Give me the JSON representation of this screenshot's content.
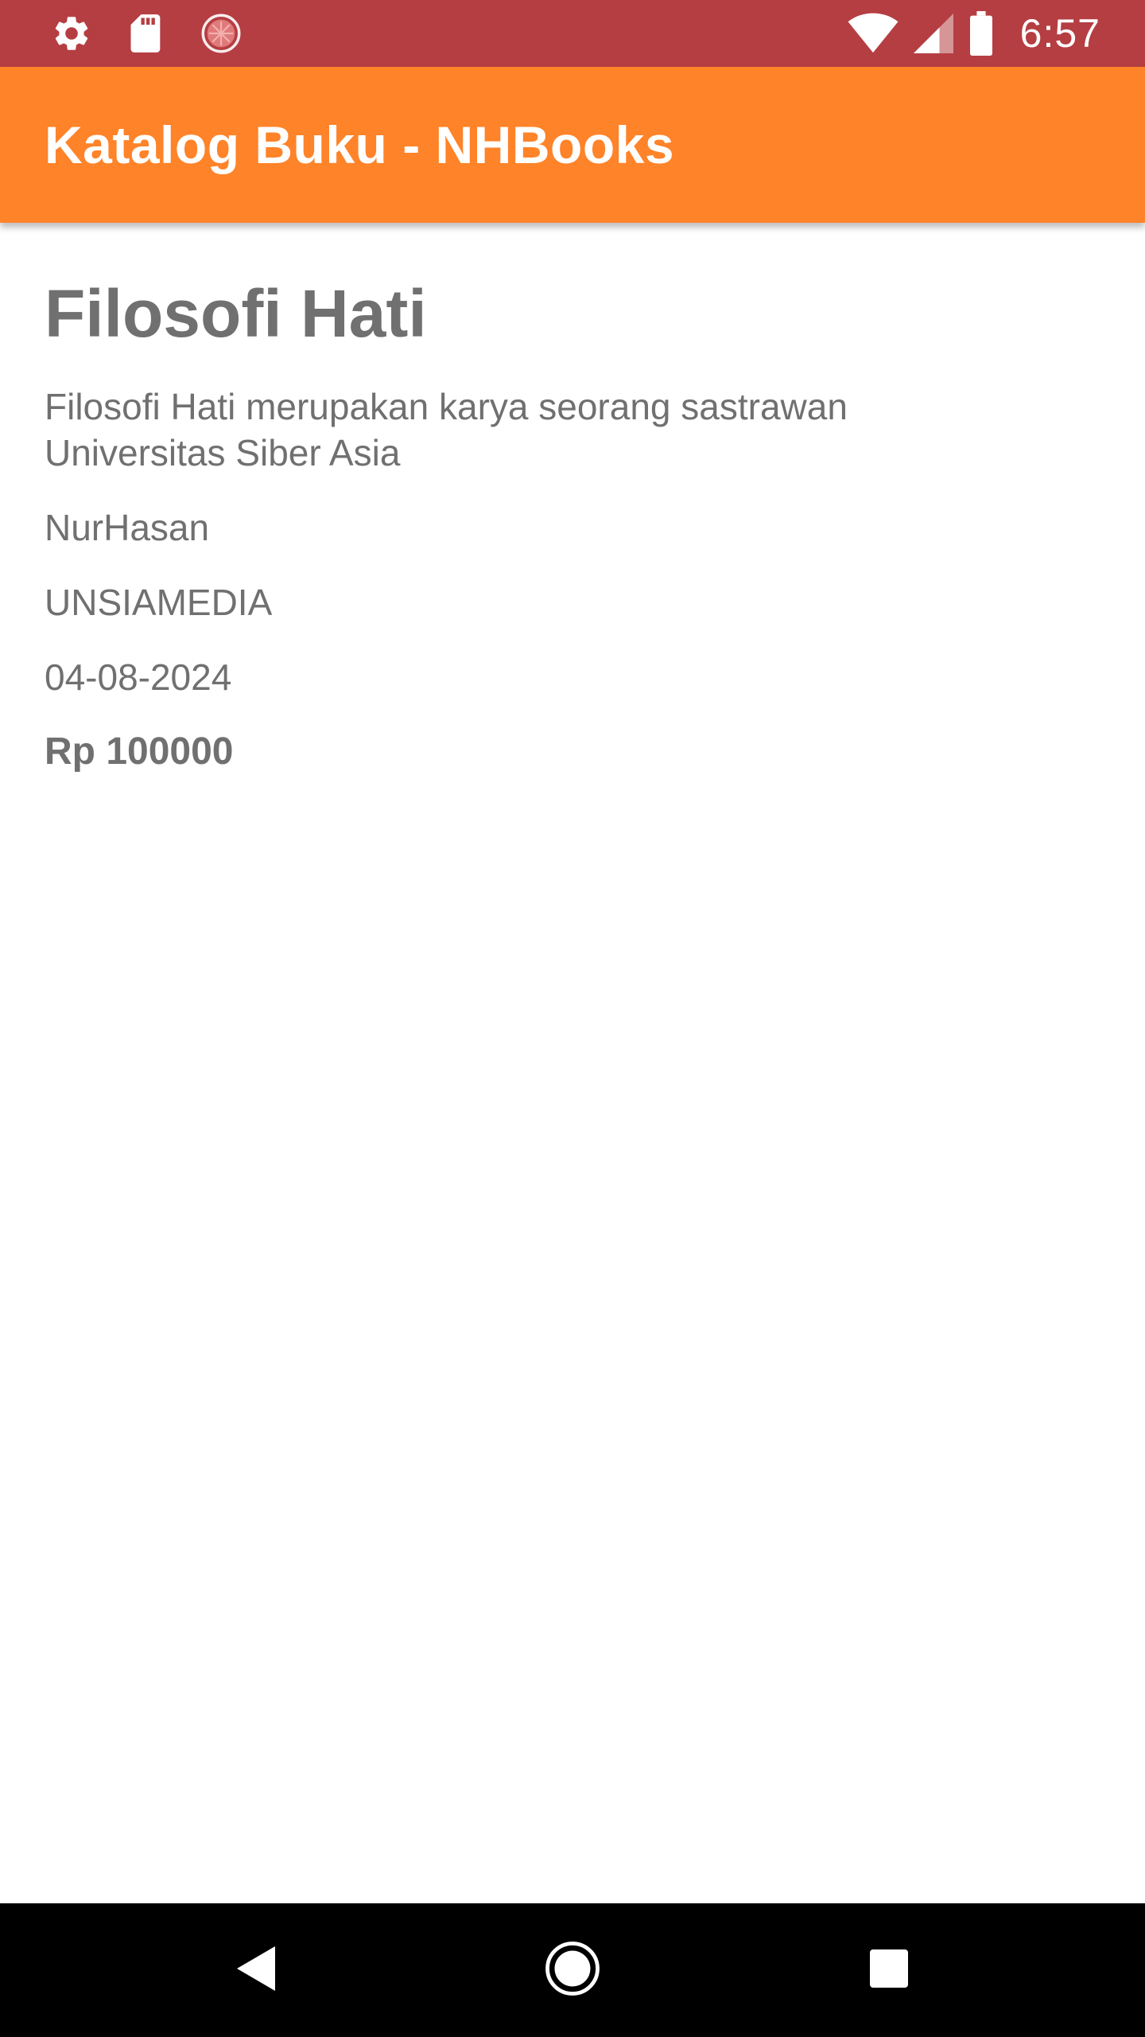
{
  "status_bar": {
    "time": "6:57",
    "background": "#b53e42",
    "left_icons": [
      "gear-icon",
      "sd-card-icon",
      "sync-progress-icon"
    ],
    "right_icons": [
      "wifi-icon",
      "cell-signal-icon",
      "battery-icon"
    ]
  },
  "app_bar": {
    "title": "Katalog Buku - NHBooks",
    "background": "#ff8329"
  },
  "book": {
    "title": "Filosofi Hati",
    "description": "Filosofi Hati merupakan karya seorang sastrawan Universitas Siber Asia",
    "author": "NurHasan",
    "publisher": "UNSIAMEDIA",
    "date": "04-08-2024",
    "price": "Rp 100000",
    "text_color": "#707070"
  },
  "nav_bar": {
    "buttons": [
      "back-icon",
      "home-icon",
      "recents-icon"
    ],
    "background": "#000000"
  }
}
